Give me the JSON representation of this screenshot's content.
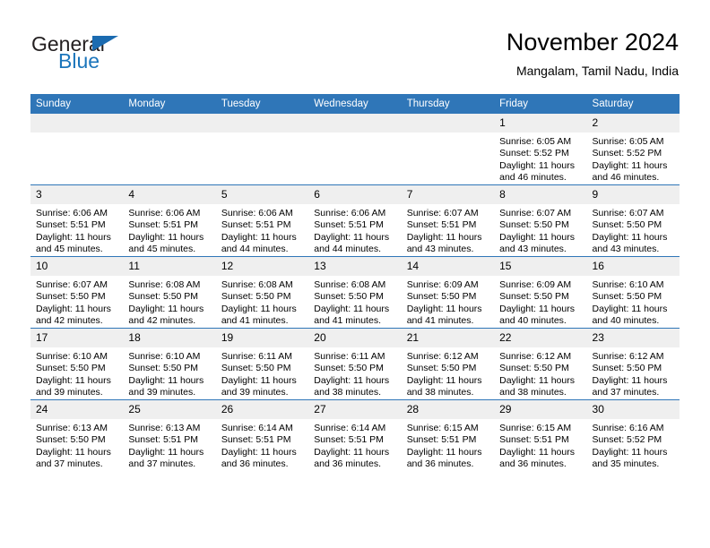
{
  "brand": {
    "word_general": "General",
    "word_blue": "Blue",
    "flag_icon": "blue-triangle-flag",
    "accent_color": "#1b6bb0"
  },
  "header": {
    "title": "November 2024",
    "subtitle": "Mangalam, Tamil Nadu, India"
  },
  "calendar": {
    "header_bg": "#2f76b8",
    "daynum_bg": "#efefef",
    "weekday_headers": [
      "Sunday",
      "Monday",
      "Tuesday",
      "Wednesday",
      "Thursday",
      "Friday",
      "Saturday"
    ],
    "weeks": [
      [
        {
          "day": "",
          "blank": true
        },
        {
          "day": "",
          "blank": true
        },
        {
          "day": "",
          "blank": true
        },
        {
          "day": "",
          "blank": true
        },
        {
          "day": "",
          "blank": true
        },
        {
          "day": "1",
          "sunrise": "Sunrise: 6:05 AM",
          "sunset": "Sunset: 5:52 PM",
          "daylight_1": "Daylight: 11 hours",
          "daylight_2": "and 46 minutes."
        },
        {
          "day": "2",
          "sunrise": "Sunrise: 6:05 AM",
          "sunset": "Sunset: 5:52 PM",
          "daylight_1": "Daylight: 11 hours",
          "daylight_2": "and 46 minutes."
        }
      ],
      [
        {
          "day": "3",
          "sunrise": "Sunrise: 6:06 AM",
          "sunset": "Sunset: 5:51 PM",
          "daylight_1": "Daylight: 11 hours",
          "daylight_2": "and 45 minutes."
        },
        {
          "day": "4",
          "sunrise": "Sunrise: 6:06 AM",
          "sunset": "Sunset: 5:51 PM",
          "daylight_1": "Daylight: 11 hours",
          "daylight_2": "and 45 minutes."
        },
        {
          "day": "5",
          "sunrise": "Sunrise: 6:06 AM",
          "sunset": "Sunset: 5:51 PM",
          "daylight_1": "Daylight: 11 hours",
          "daylight_2": "and 44 minutes."
        },
        {
          "day": "6",
          "sunrise": "Sunrise: 6:06 AM",
          "sunset": "Sunset: 5:51 PM",
          "daylight_1": "Daylight: 11 hours",
          "daylight_2": "and 44 minutes."
        },
        {
          "day": "7",
          "sunrise": "Sunrise: 6:07 AM",
          "sunset": "Sunset: 5:51 PM",
          "daylight_1": "Daylight: 11 hours",
          "daylight_2": "and 43 minutes."
        },
        {
          "day": "8",
          "sunrise": "Sunrise: 6:07 AM",
          "sunset": "Sunset: 5:50 PM",
          "daylight_1": "Daylight: 11 hours",
          "daylight_2": "and 43 minutes."
        },
        {
          "day": "9",
          "sunrise": "Sunrise: 6:07 AM",
          "sunset": "Sunset: 5:50 PM",
          "daylight_1": "Daylight: 11 hours",
          "daylight_2": "and 43 minutes."
        }
      ],
      [
        {
          "day": "10",
          "sunrise": "Sunrise: 6:07 AM",
          "sunset": "Sunset: 5:50 PM",
          "daylight_1": "Daylight: 11 hours",
          "daylight_2": "and 42 minutes."
        },
        {
          "day": "11",
          "sunrise": "Sunrise: 6:08 AM",
          "sunset": "Sunset: 5:50 PM",
          "daylight_1": "Daylight: 11 hours",
          "daylight_2": "and 42 minutes."
        },
        {
          "day": "12",
          "sunrise": "Sunrise: 6:08 AM",
          "sunset": "Sunset: 5:50 PM",
          "daylight_1": "Daylight: 11 hours",
          "daylight_2": "and 41 minutes."
        },
        {
          "day": "13",
          "sunrise": "Sunrise: 6:08 AM",
          "sunset": "Sunset: 5:50 PM",
          "daylight_1": "Daylight: 11 hours",
          "daylight_2": "and 41 minutes."
        },
        {
          "day": "14",
          "sunrise": "Sunrise: 6:09 AM",
          "sunset": "Sunset: 5:50 PM",
          "daylight_1": "Daylight: 11 hours",
          "daylight_2": "and 41 minutes."
        },
        {
          "day": "15",
          "sunrise": "Sunrise: 6:09 AM",
          "sunset": "Sunset: 5:50 PM",
          "daylight_1": "Daylight: 11 hours",
          "daylight_2": "and 40 minutes."
        },
        {
          "day": "16",
          "sunrise": "Sunrise: 6:10 AM",
          "sunset": "Sunset: 5:50 PM",
          "daylight_1": "Daylight: 11 hours",
          "daylight_2": "and 40 minutes."
        }
      ],
      [
        {
          "day": "17",
          "sunrise": "Sunrise: 6:10 AM",
          "sunset": "Sunset: 5:50 PM",
          "daylight_1": "Daylight: 11 hours",
          "daylight_2": "and 39 minutes."
        },
        {
          "day": "18",
          "sunrise": "Sunrise: 6:10 AM",
          "sunset": "Sunset: 5:50 PM",
          "daylight_1": "Daylight: 11 hours",
          "daylight_2": "and 39 minutes."
        },
        {
          "day": "19",
          "sunrise": "Sunrise: 6:11 AM",
          "sunset": "Sunset: 5:50 PM",
          "daylight_1": "Daylight: 11 hours",
          "daylight_2": "and 39 minutes."
        },
        {
          "day": "20",
          "sunrise": "Sunrise: 6:11 AM",
          "sunset": "Sunset: 5:50 PM",
          "daylight_1": "Daylight: 11 hours",
          "daylight_2": "and 38 minutes."
        },
        {
          "day": "21",
          "sunrise": "Sunrise: 6:12 AM",
          "sunset": "Sunset: 5:50 PM",
          "daylight_1": "Daylight: 11 hours",
          "daylight_2": "and 38 minutes."
        },
        {
          "day": "22",
          "sunrise": "Sunrise: 6:12 AM",
          "sunset": "Sunset: 5:50 PM",
          "daylight_1": "Daylight: 11 hours",
          "daylight_2": "and 38 minutes."
        },
        {
          "day": "23",
          "sunrise": "Sunrise: 6:12 AM",
          "sunset": "Sunset: 5:50 PM",
          "daylight_1": "Daylight: 11 hours",
          "daylight_2": "and 37 minutes."
        }
      ],
      [
        {
          "day": "24",
          "sunrise": "Sunrise: 6:13 AM",
          "sunset": "Sunset: 5:50 PM",
          "daylight_1": "Daylight: 11 hours",
          "daylight_2": "and 37 minutes."
        },
        {
          "day": "25",
          "sunrise": "Sunrise: 6:13 AM",
          "sunset": "Sunset: 5:51 PM",
          "daylight_1": "Daylight: 11 hours",
          "daylight_2": "and 37 minutes."
        },
        {
          "day": "26",
          "sunrise": "Sunrise: 6:14 AM",
          "sunset": "Sunset: 5:51 PM",
          "daylight_1": "Daylight: 11 hours",
          "daylight_2": "and 36 minutes."
        },
        {
          "day": "27",
          "sunrise": "Sunrise: 6:14 AM",
          "sunset": "Sunset: 5:51 PM",
          "daylight_1": "Daylight: 11 hours",
          "daylight_2": "and 36 minutes."
        },
        {
          "day": "28",
          "sunrise": "Sunrise: 6:15 AM",
          "sunset": "Sunset: 5:51 PM",
          "daylight_1": "Daylight: 11 hours",
          "daylight_2": "and 36 minutes."
        },
        {
          "day": "29",
          "sunrise": "Sunrise: 6:15 AM",
          "sunset": "Sunset: 5:51 PM",
          "daylight_1": "Daylight: 11 hours",
          "daylight_2": "and 36 minutes."
        },
        {
          "day": "30",
          "sunrise": "Sunrise: 6:16 AM",
          "sunset": "Sunset: 5:52 PM",
          "daylight_1": "Daylight: 11 hours",
          "daylight_2": "and 35 minutes."
        }
      ]
    ]
  }
}
